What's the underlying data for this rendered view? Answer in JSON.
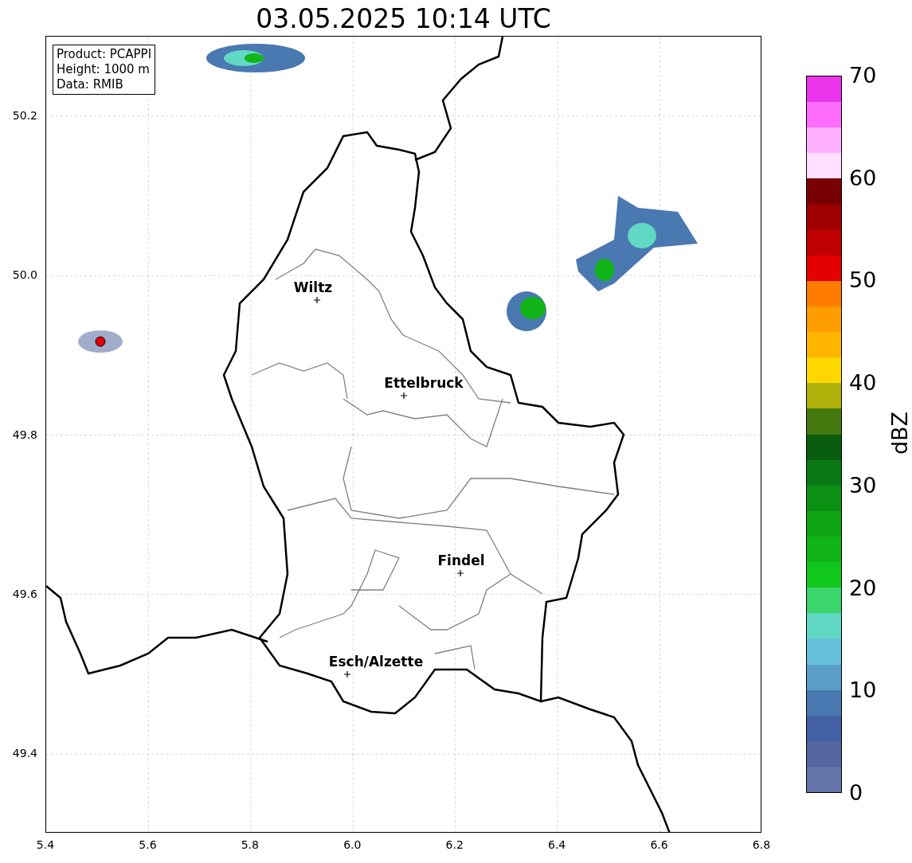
{
  "title": "03.05.2025 10:14 UTC",
  "info_box": [
    "Product: PCAPPI",
    "Height: 1000 m",
    "Data: RMIB"
  ],
  "cities": [
    "Wiltz",
    "Ettelbruck",
    "Findel",
    "Esch/Alzette"
  ],
  "x_ticks": [
    "5.4",
    "5.6",
    "5.8",
    "6.0",
    "6.2",
    "6.4",
    "6.6",
    "6.8"
  ],
  "y_ticks": [
    "50.2",
    "50.0",
    "49.8",
    "49.6",
    "49.4"
  ],
  "colorbar": {
    "label": "dBZ",
    "ticks": [
      "70",
      "60",
      "50",
      "40",
      "30",
      "20",
      "10",
      "0"
    ]
  }
}
